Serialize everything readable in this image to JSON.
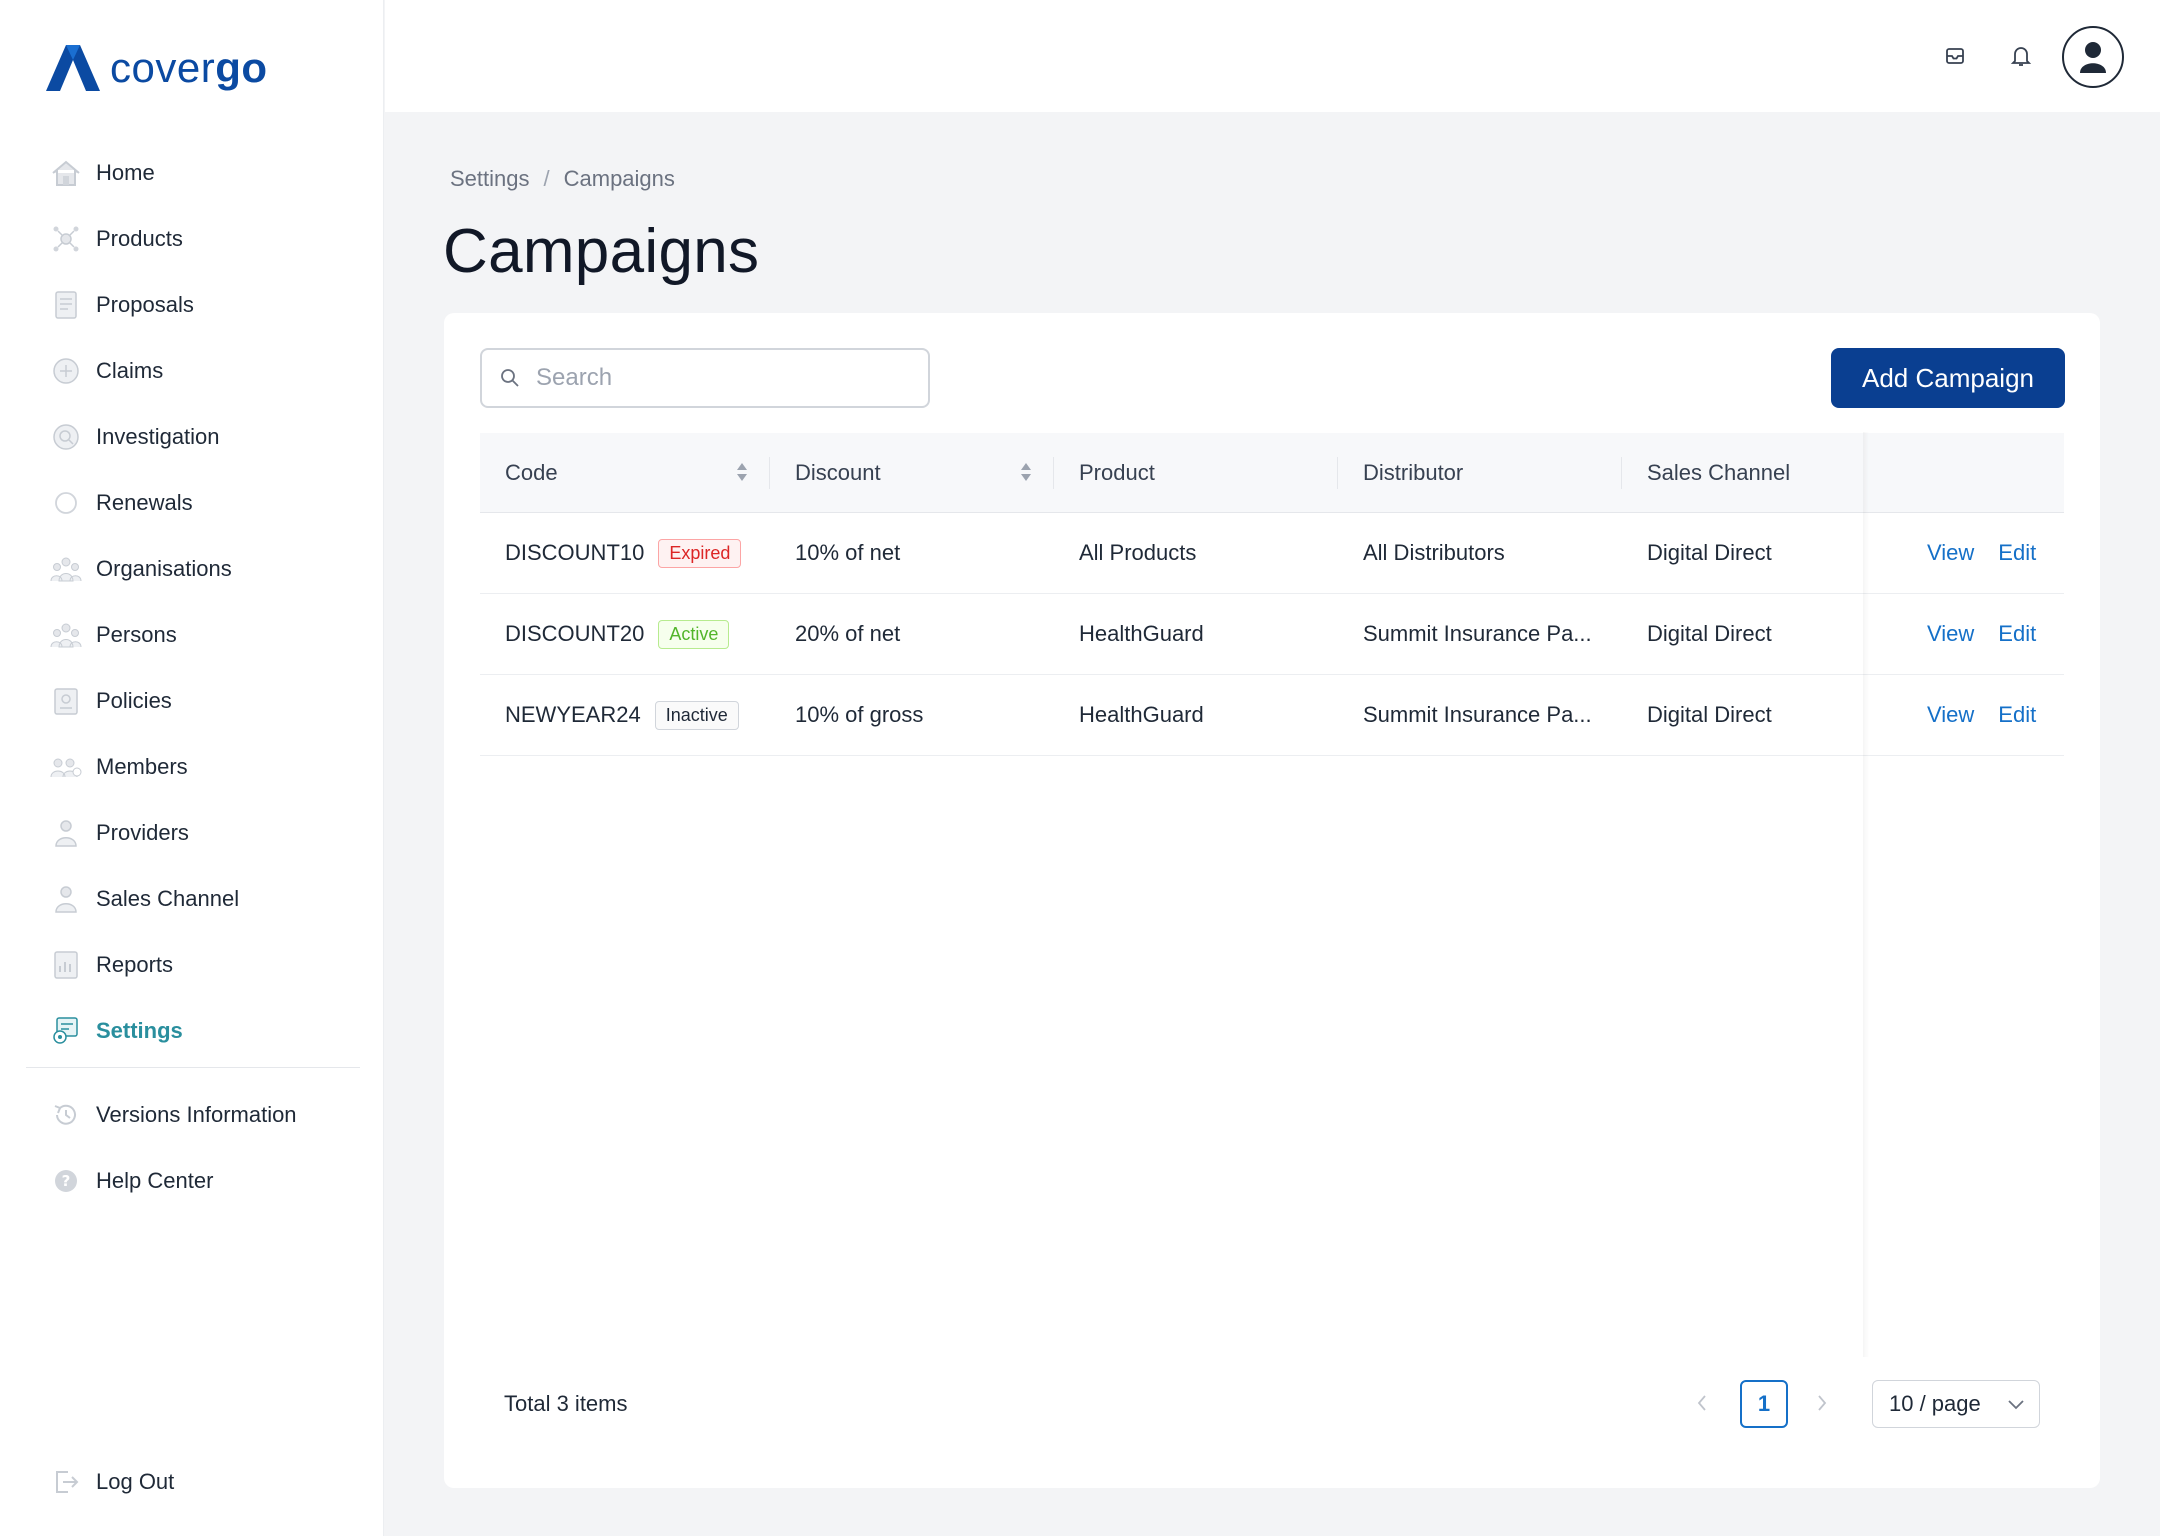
{
  "brand": {
    "name_light": "cover",
    "name_bold": "go",
    "color": "#0b4aa2"
  },
  "sidebar": {
    "items": [
      {
        "label": "Home",
        "icon": "home-icon"
      },
      {
        "label": "Products",
        "icon": "products-icon"
      },
      {
        "label": "Proposals",
        "icon": "proposals-icon"
      },
      {
        "label": "Claims",
        "icon": "claims-icon"
      },
      {
        "label": "Investigation",
        "icon": "investigation-icon"
      },
      {
        "label": "Renewals",
        "icon": "renewals-icon"
      },
      {
        "label": "Organisations",
        "icon": "organisations-icon"
      },
      {
        "label": "Persons",
        "icon": "persons-icon"
      },
      {
        "label": "Policies",
        "icon": "policies-icon"
      },
      {
        "label": "Members",
        "icon": "members-icon"
      },
      {
        "label": "Providers",
        "icon": "providers-icon"
      },
      {
        "label": "Sales Channel",
        "icon": "sales-channel-icon"
      },
      {
        "label": "Reports",
        "icon": "reports-icon"
      },
      {
        "label": "Settings",
        "icon": "settings-icon",
        "active": true
      }
    ],
    "secondary": [
      {
        "label": "Versions Information",
        "icon": "history-icon"
      },
      {
        "label": "Help Center",
        "icon": "help-icon"
      }
    ],
    "logout_label": "Log Out",
    "active_color": "#2a8f9e"
  },
  "breadcrumb": {
    "items": [
      "Settings",
      "Campaigns"
    ],
    "separator": "/"
  },
  "page_title": "Campaigns",
  "search": {
    "placeholder": "Search",
    "value": ""
  },
  "add_button_label": "Add Campaign",
  "table": {
    "columns": [
      "Code",
      "Discount",
      "Product",
      "Distributor",
      "Sales Channel"
    ],
    "rows": [
      {
        "code": "DISCOUNT10",
        "status": "Expired",
        "discount": "10% of net",
        "product": "All Products",
        "distributor": "All Distributors",
        "channel": "Digital Direct",
        "view": "View",
        "edit": "Edit"
      },
      {
        "code": "DISCOUNT20",
        "status": "Active",
        "discount": "20% of net",
        "product": "HealthGuard",
        "distributor": "Summit Insurance Pa...",
        "channel": "Digital Direct",
        "view": "View",
        "edit": "Edit"
      },
      {
        "code": "NEWYEAR24",
        "status": "Inactive",
        "discount": "10% of gross",
        "product": "HealthGuard",
        "distributor": "Summit Insurance Pa...",
        "channel": "Digital Direct",
        "view": "View",
        "edit": "Edit"
      }
    ]
  },
  "pagination": {
    "total_text": "Total 3 items",
    "current_page": "1",
    "page_size": "10 / page"
  },
  "colors": {
    "primary_button": "#0a3f91",
    "link": "#1570c8",
    "expired": "#dc2626",
    "active": "#52b52a"
  }
}
